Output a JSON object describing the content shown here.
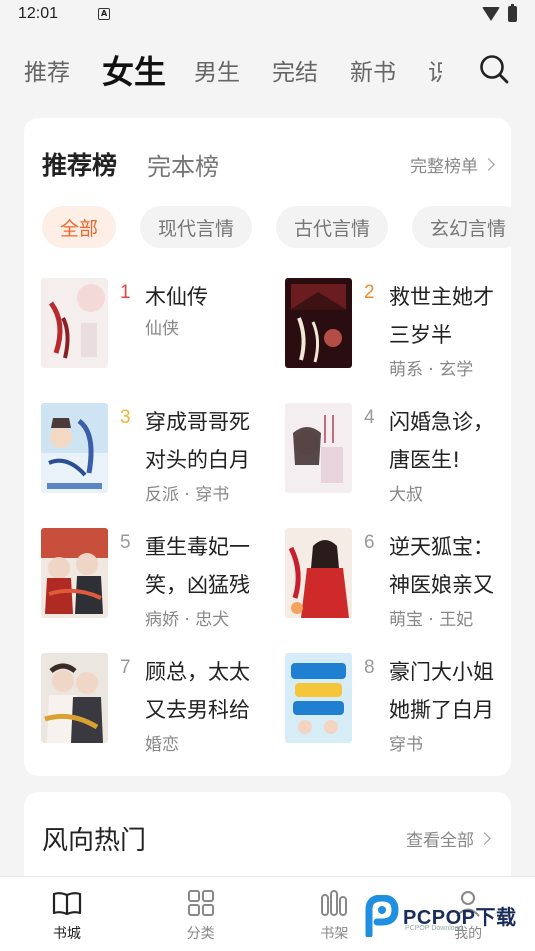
{
  "status_bar": {
    "time": "12:01",
    "notif": "A"
  },
  "top_tabs": [
    "推荐",
    "女生",
    "男生",
    "完结",
    "新书",
    "识"
  ],
  "rank_card": {
    "tabs": [
      "推荐榜",
      "完本榜"
    ],
    "more": "完整榜单",
    "chips": [
      "全部",
      "现代言情",
      "古代言情",
      "玄幻言情"
    ],
    "books": [
      {
        "rank": "1",
        "title": "木仙传",
        "tags": "仙侠"
      },
      {
        "rank": "2",
        "title": "救世主她才三岁半",
        "tags": "萌系 · 玄学"
      },
      {
        "rank": "3",
        "title": "穿成哥哥死对头的白月",
        "tags": "反派 · 穿书"
      },
      {
        "rank": "4",
        "title": "闪婚急诊，唐医生!",
        "tags": "大叔"
      },
      {
        "rank": "5",
        "title": "重生毒妃一笑，凶猛残",
        "tags": "病娇 · 忠犬"
      },
      {
        "rank": "6",
        "title": "逆天狐宝：神医娘亲又",
        "tags": "萌宝 · 王妃"
      },
      {
        "rank": "7",
        "title": "顾总，太太又去男科给",
        "tags": "婚恋"
      },
      {
        "rank": "8",
        "title": "豪门大小姐她撕了白月",
        "tags": "穿书"
      }
    ]
  },
  "hot_card": {
    "title": "风向热门",
    "more": "查看全部"
  },
  "bottom_nav": [
    "书城",
    "分类",
    "书架",
    "我的"
  ],
  "watermark": {
    "brand": "PCPOP下载",
    "sub": "PCPOP Download"
  },
  "colors": {
    "accent": "#f0662e",
    "rank1": "#e74640",
    "rank2": "#f08a2c",
    "rank3": "#f3b431"
  }
}
